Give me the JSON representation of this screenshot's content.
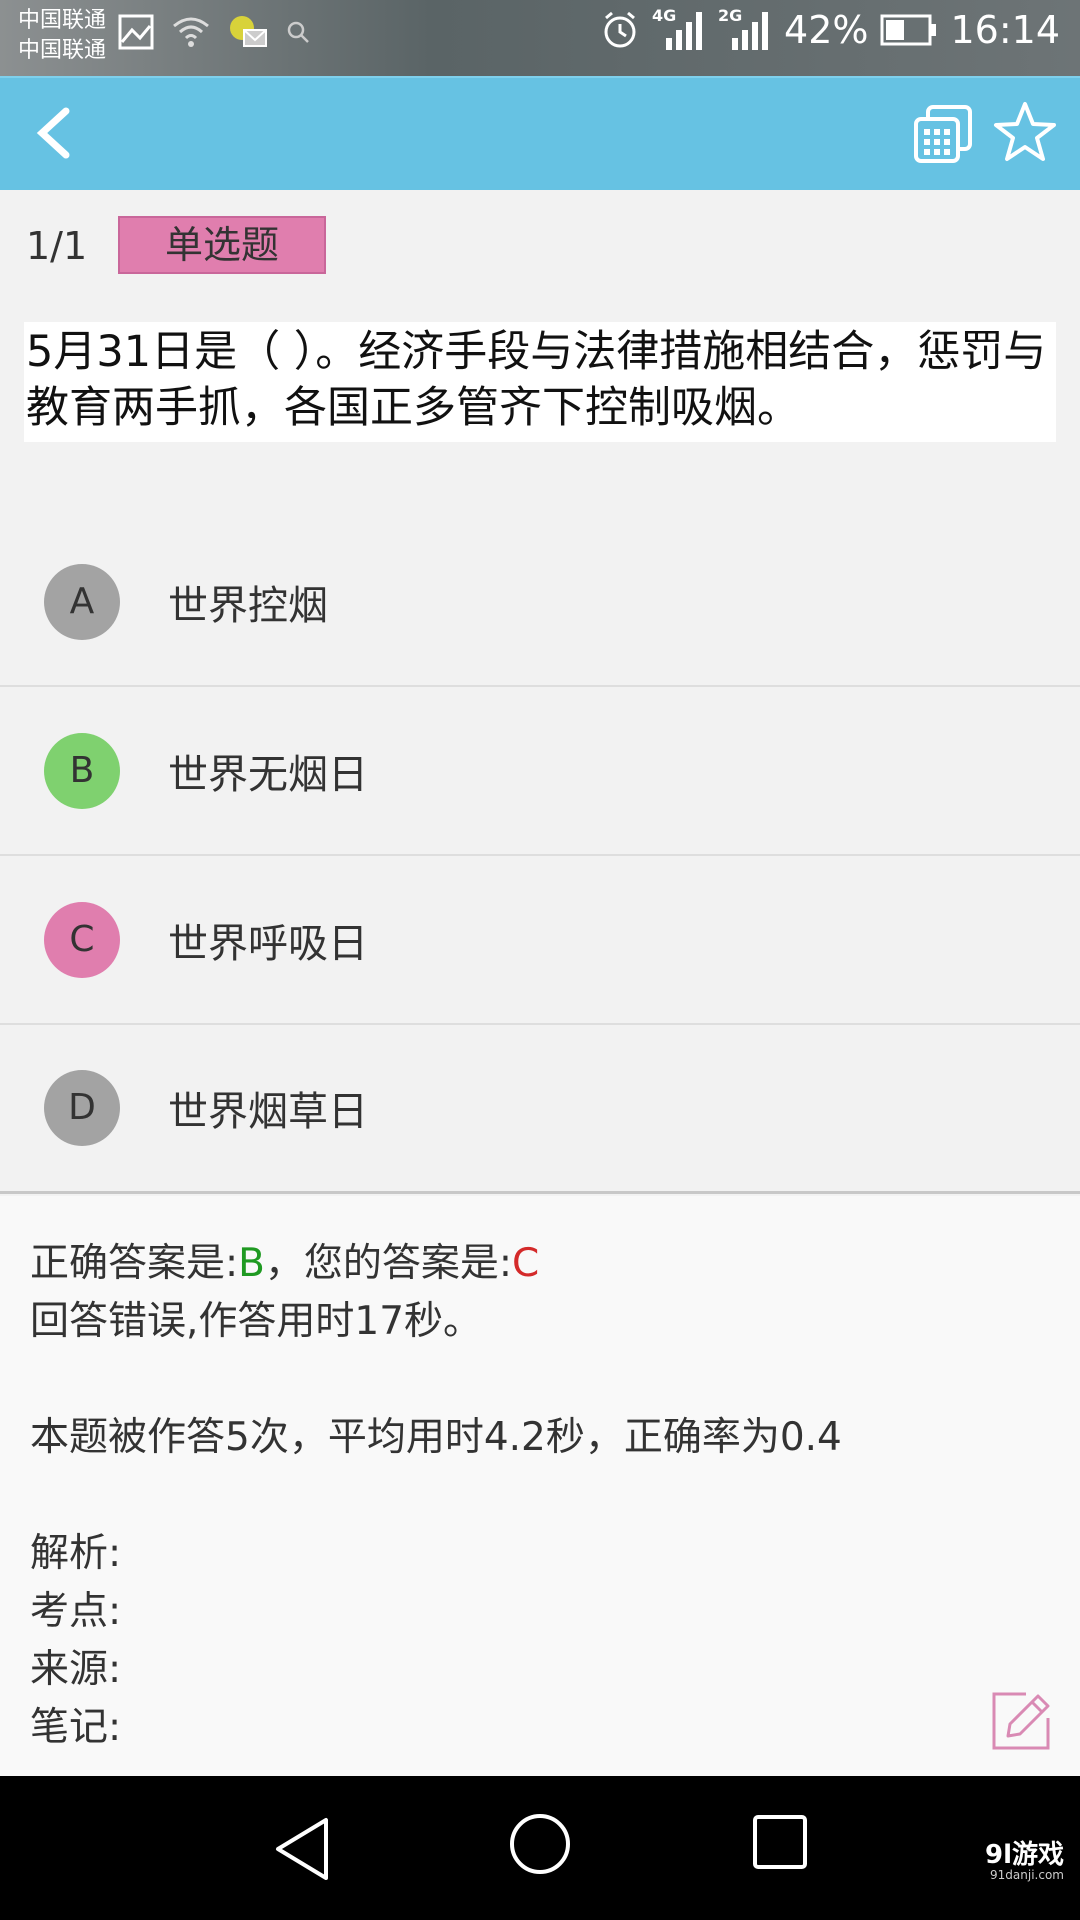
{
  "status_bar": {
    "carrier_1": "中国联通",
    "carrier_2": "中国联通",
    "network_1": "4G",
    "network_2": "2G",
    "battery": "42%",
    "time": "16:14"
  },
  "header": {
    "back_icon": "chevron-left-icon",
    "copy_icon": "copy-icon",
    "star_icon": "star-icon"
  },
  "quiz": {
    "progress": "1/1",
    "type": "单选题",
    "question": "5月31日是（ ）。经济手段与法律措施相结合，惩罚与教育两手抓，各国正多管齐下控制吸烟。",
    "options": [
      {
        "letter": "A",
        "text": "世界控烟",
        "color": "#a3a3a3"
      },
      {
        "letter": "B",
        "text": "世界无烟日",
        "color": "#7fd16f"
      },
      {
        "letter": "C",
        "text": "世界呼吸日",
        "color": "#e07eae"
      },
      {
        "letter": "D",
        "text": "世界烟草日",
        "color": "#a3a3a3"
      }
    ]
  },
  "result": {
    "correct_prefix": "正确答案是:",
    "correct_answer": "B",
    "your_prefix": "，您的答案是:",
    "your_answer": "C",
    "status": "回答错误,作答用时17秒。",
    "stats": "本题被作答5次，平均用时4.2秒，正确率为0.4",
    "analysis_label": "解析:",
    "point_label": "考点:",
    "source_label": "来源:",
    "notes_label": "笔记:"
  },
  "watermark": {
    "brand": "9l游戏",
    "domain": "91danji.com"
  },
  "colors": {
    "app_bar": "#66c2e3",
    "type_badge": "#e07eae",
    "correct": "#1f9a22",
    "wrong": "#d42a2a"
  }
}
